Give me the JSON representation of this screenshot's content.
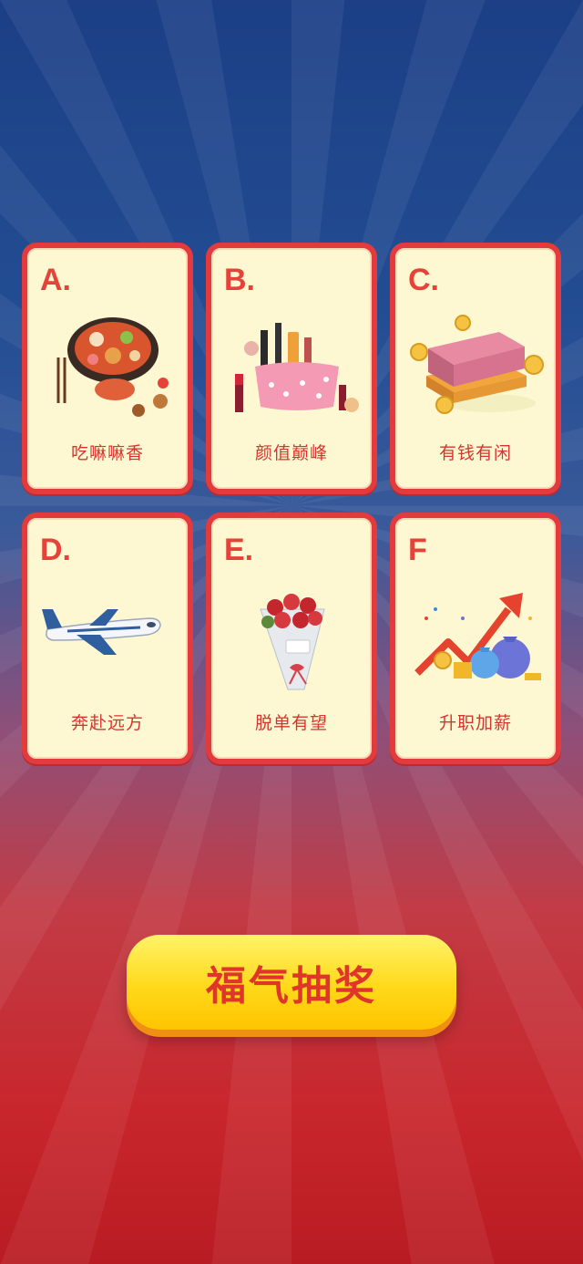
{
  "cards": [
    {
      "letter": "A.",
      "label": "吃嘛嘛香",
      "icon": "hotpot-icon"
    },
    {
      "letter": "B.",
      "label": "颜值巅峰",
      "icon": "cosmetics-icon"
    },
    {
      "letter": "C.",
      "label": "有钱有闲",
      "icon": "money-stack-icon"
    },
    {
      "letter": "D.",
      "label": "奔赴远方",
      "icon": "airplane-icon"
    },
    {
      "letter": "E.",
      "label": "脱单有望",
      "icon": "rose-bouquet-icon"
    },
    {
      "letter": "F",
      "label": "升职加薪",
      "icon": "money-bags-icon"
    }
  ],
  "draw_button": {
    "label": "福气抽奖"
  },
  "colors": {
    "accent": "#e23a3d",
    "card_bg": "#fdf8d2",
    "button": "#ffd91a",
    "text": "#d8342e"
  }
}
